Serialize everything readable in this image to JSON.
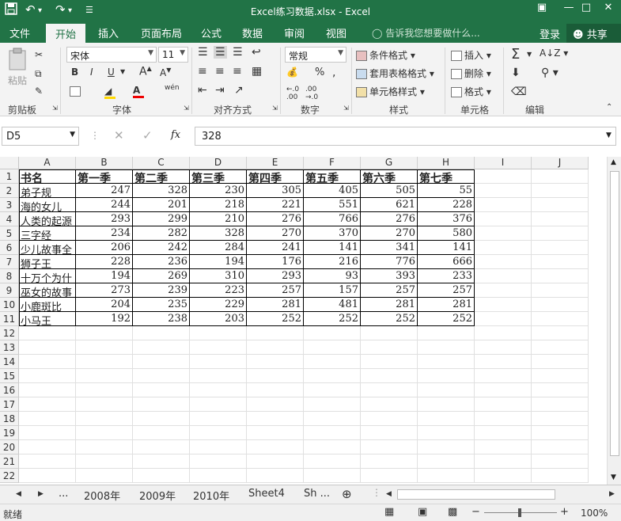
{
  "titlebar": {
    "title": "Excel练习数据.xlsx - Excel",
    "save_icon": "save-icon",
    "undo_icon": "undo-icon",
    "redo_icon": "redo-icon"
  },
  "tabs": [
    "文件",
    "开始",
    "插入",
    "页面布局",
    "公式",
    "数据",
    "审阅",
    "视图"
  ],
  "tellme": "告诉我您想要做什么...",
  "login": "登录",
  "share": "共享",
  "ribbon": {
    "clipboard": {
      "paste": "粘贴",
      "label": "剪贴板"
    },
    "font": {
      "name": "宋体",
      "size": "11",
      "label": "字体",
      "bold": "B",
      "italic": "I",
      "underline": "U"
    },
    "alignment": {
      "label": "对齐方式"
    },
    "number": {
      "format": "常规",
      "label": "数字"
    },
    "styles": {
      "conditional": "条件格式",
      "table": "套用表格格式",
      "cell": "单元格样式",
      "label": "样式"
    },
    "cells": {
      "insert": "插入",
      "delete": "删除",
      "format": "格式",
      "label": "单元格"
    },
    "editing": {
      "label": "编辑"
    }
  },
  "formula": {
    "namebox": "D5",
    "value": "328",
    "fx": "fx"
  },
  "columns": [
    "A",
    "B",
    "C",
    "D",
    "E",
    "F",
    "G",
    "H",
    "I",
    "J"
  ],
  "rows": [
    "1",
    "2",
    "3",
    "4",
    "5",
    "6",
    "7",
    "8",
    "9",
    "10",
    "11",
    "12",
    "13",
    "14",
    "15",
    "16",
    "17",
    "18",
    "19",
    "20",
    "21",
    "22"
  ],
  "table": {
    "header": [
      "书名",
      "第一季",
      "第二季",
      "第三季",
      "第四季",
      "第五季",
      "第六季",
      "第七季"
    ],
    "body": [
      [
        "弟子规",
        "247",
        "328",
        "230",
        "305",
        "405",
        "505",
        "55"
      ],
      [
        "海的女儿",
        "244",
        "201",
        "218",
        "221",
        "551",
        "621",
        "228"
      ],
      [
        "人类的起源",
        "293",
        "299",
        "210",
        "276",
        "766",
        "276",
        "376"
      ],
      [
        "三字经",
        "234",
        "282",
        "328",
        "270",
        "370",
        "270",
        "580"
      ],
      [
        "少儿故事全",
        "206",
        "242",
        "284",
        "241",
        "141",
        "341",
        "141"
      ],
      [
        "狮子王",
        "228",
        "236",
        "194",
        "176",
        "216",
        "776",
        "666"
      ],
      [
        "十万个为什",
        "194",
        "269",
        "310",
        "293",
        "93",
        "393",
        "233"
      ],
      [
        "巫女的故事",
        "273",
        "239",
        "223",
        "257",
        "157",
        "257",
        "257"
      ],
      [
        "小鹿斑比",
        "204",
        "235",
        "229",
        "281",
        "481",
        "281",
        "281"
      ],
      [
        "小马王",
        "192",
        "238",
        "203",
        "252",
        "252",
        "252",
        "252"
      ]
    ]
  },
  "sheets": [
    "2008年",
    "2009年",
    "2010年",
    "Sheet4",
    "Sh ..."
  ],
  "status": {
    "ready": "就绪",
    "zoom": "100%"
  }
}
